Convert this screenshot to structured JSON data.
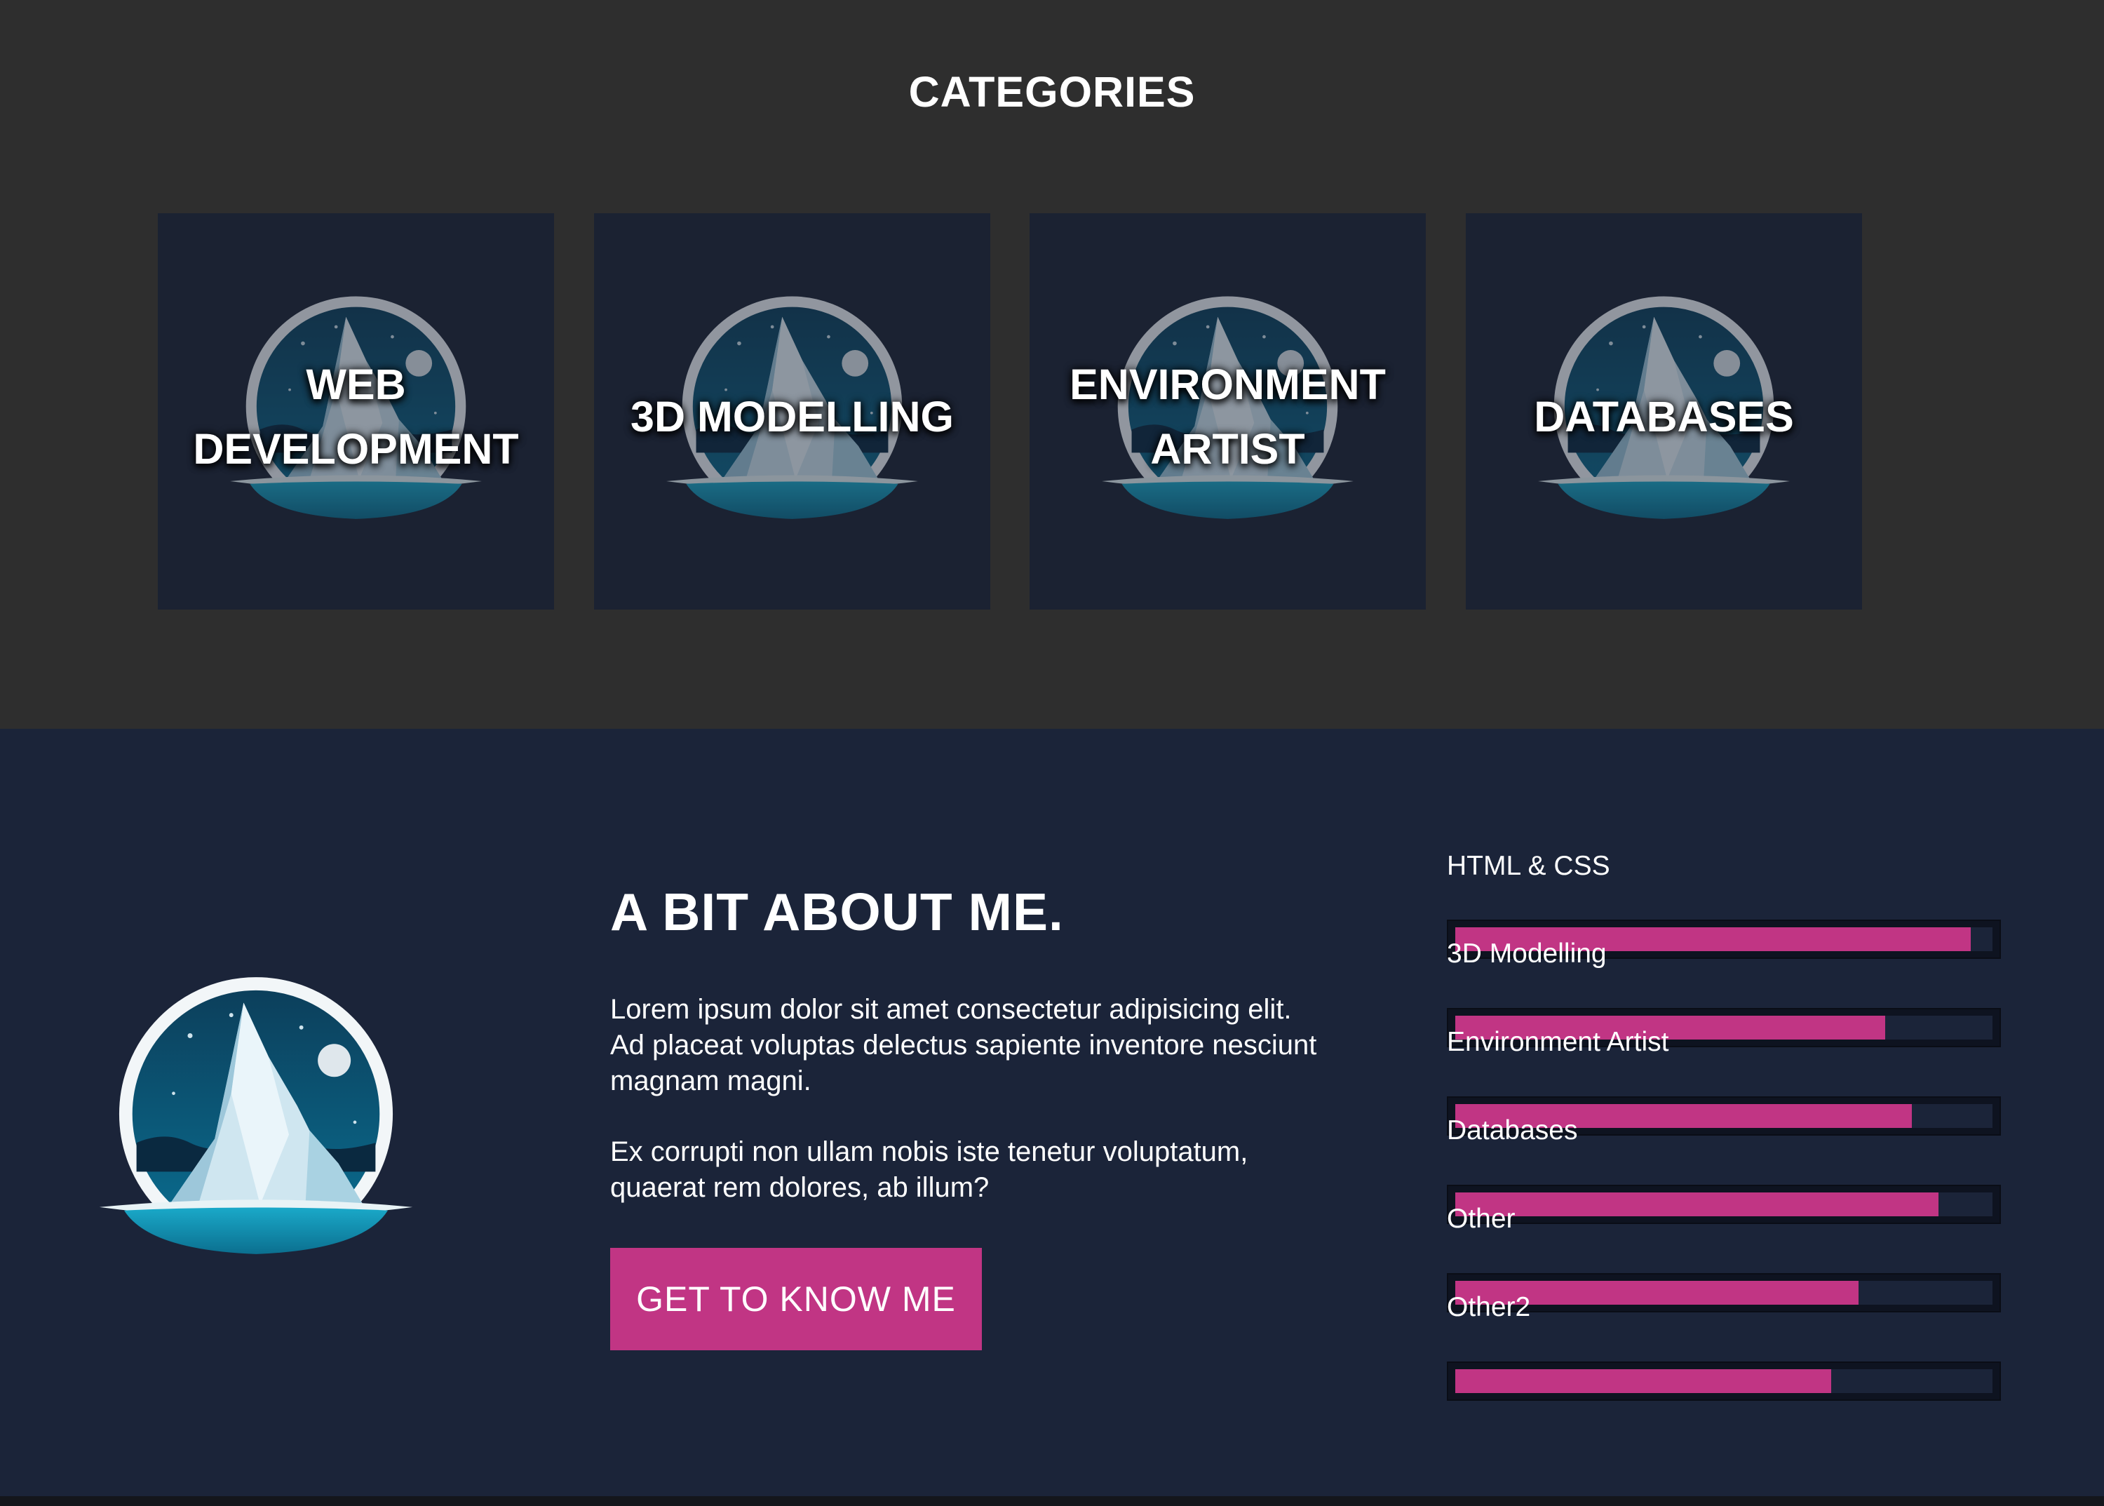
{
  "categories": {
    "heading": "CATEGORIES",
    "cards": [
      {
        "line1": "WEB",
        "line2": "DEVELOPMENT"
      },
      {
        "line1": "3D MODELLING",
        "line2": ""
      },
      {
        "line1": "ENVIRONMENT",
        "line2": "ARTIST"
      },
      {
        "line1": "DATABASES",
        "line2": ""
      }
    ]
  },
  "about": {
    "title": "A BIT ABOUT ME.",
    "paragraph1": "Lorem ipsum dolor sit amet consectetur adipisicing elit. Ad placeat voluptas delectus sapiente inventore nesciunt magnam magni.",
    "paragraph2": "Ex corrupti non ullam nobis iste tenetur voluptatum, quaerat rem dolores, ab illum?",
    "cta_label": "GET TO KNOW ME"
  },
  "skills": [
    {
      "label": "HTML & CSS",
      "level": 0.96
    },
    {
      "label": "3D Modelling",
      "level": 0.8
    },
    {
      "label": "Environment Artist",
      "level": 0.85
    },
    {
      "label": "Databases",
      "level": 0.9
    },
    {
      "label": "Other",
      "level": 0.75
    },
    {
      "label": "Other2",
      "level": 0.7
    }
  ],
  "colors": {
    "accent": "#c13584",
    "categories_bg": "#2e2e2e",
    "card_bg": "#1b2232",
    "about_bg": "#1b2439"
  },
  "icons": {
    "category_emblem": "iceberg-emblem-icon",
    "about_logo": "iceberg-logo-icon"
  }
}
